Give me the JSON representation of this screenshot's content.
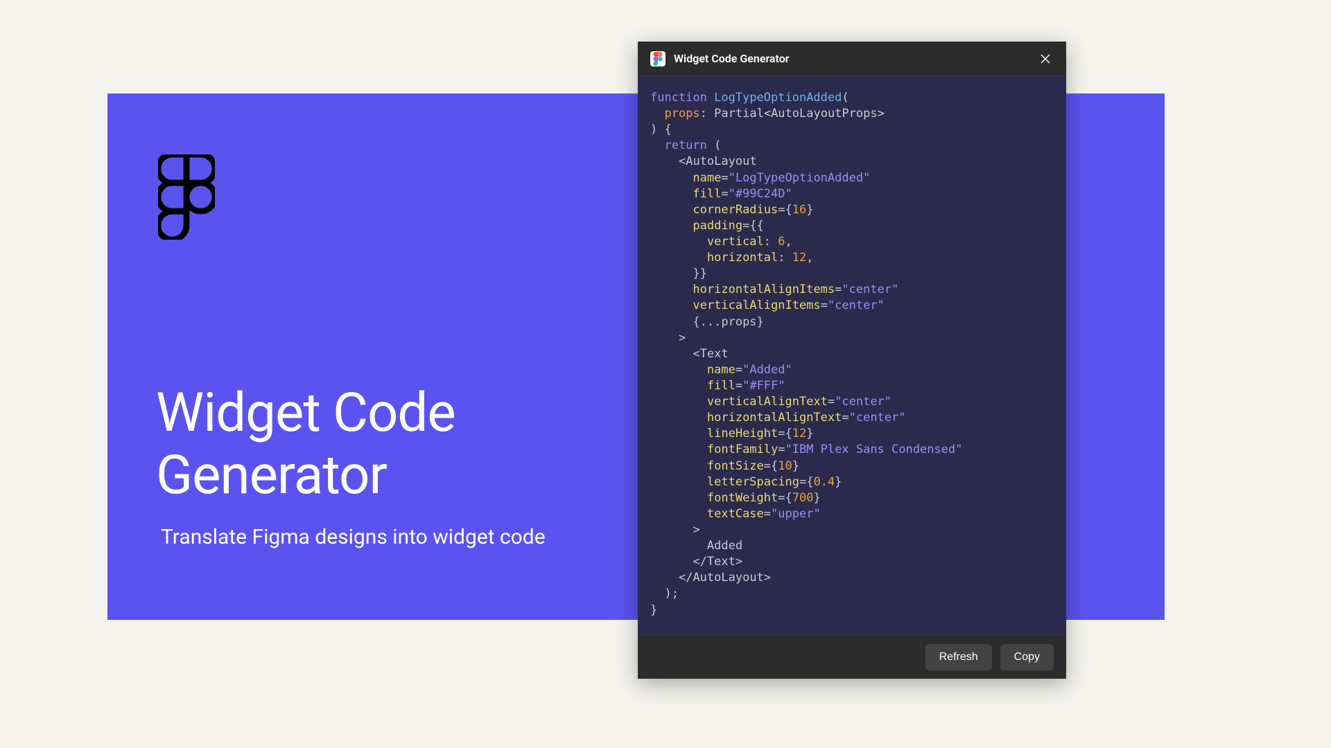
{
  "hero": {
    "title_line1": "Widget Code",
    "title_line2": "Generator",
    "subtitle": "Translate Figma designs into widget code"
  },
  "window": {
    "title": "Widget Code Generator",
    "refresh_label": "Refresh",
    "copy_label": "Copy"
  },
  "code": {
    "function_keyword": "function",
    "function_name": "LogTypeOptionAdded",
    "props_param": "props",
    "partial_type": "Partial",
    "autolayout_props_type": "AutoLayoutProps",
    "return_keyword": "return",
    "autolayout_tag": "AutoLayout",
    "text_tag": "Text",
    "attr_name": "name",
    "attr_fill": "fill",
    "attr_cornerRadius": "cornerRadius",
    "attr_padding": "padding",
    "attr_vertical": "vertical",
    "attr_horizontal": "horizontal",
    "attr_horizontalAlignItems": "horizontalAlignItems",
    "attr_verticalAlignItems": "verticalAlignItems",
    "attr_verticalAlignText": "verticalAlignText",
    "attr_horizontalAlignText": "horizontalAlignText",
    "attr_lineHeight": "lineHeight",
    "attr_fontFamily": "fontFamily",
    "attr_fontSize": "fontSize",
    "attr_letterSpacing": "letterSpacing",
    "attr_fontWeight": "fontWeight",
    "attr_textCase": "textCase",
    "val_name1": "\"LogTypeOptionAdded\"",
    "val_fill1": "\"#99C24D\"",
    "val_cornerRadius": "16",
    "val_vertical": "6",
    "val_horizontal": "12",
    "val_center": "\"center\"",
    "spread_props": "{...props}",
    "val_name2": "\"Added\"",
    "val_fill2": "\"#FFF\"",
    "val_lineHeight": "12",
    "val_fontFamily": "\"IBM Plex Sans Condensed\"",
    "val_fontSize": "10",
    "val_letterSpacing": "0.4",
    "val_fontWeight": "700",
    "val_textCase": "\"upper\"",
    "text_content": "Added"
  }
}
